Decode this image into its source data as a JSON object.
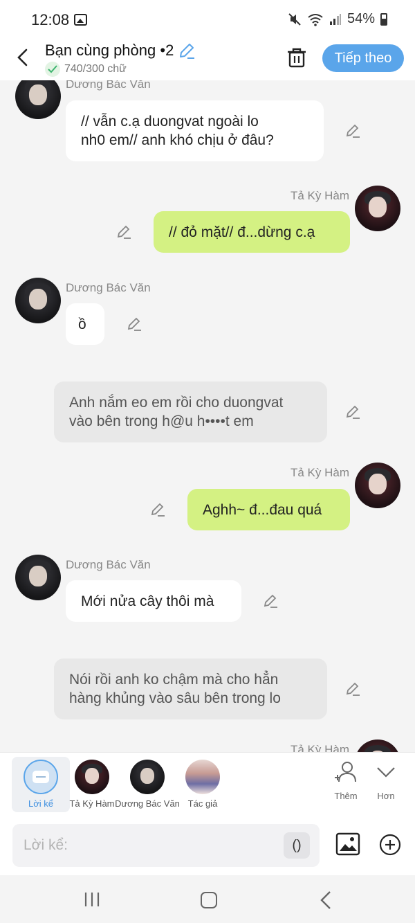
{
  "status_bar": {
    "time": "12:08",
    "battery": "54%"
  },
  "header": {
    "title": "Bạn cùng phòng •2",
    "subtitle": "740/300 chữ",
    "next_label": "Tiếp theo"
  },
  "messages": [
    {
      "sender": "Dương Bác Văn",
      "side": "left",
      "style": "white",
      "lines": [
        "// vẫn c.ạ duongvat ngoài lo",
        "nh0 em// anh khó chịu ở đâu?"
      ]
    },
    {
      "sender": "Tả Kỳ Hàm",
      "side": "right",
      "style": "green",
      "lines": [
        "// đỏ mặt// đ...dừng c.ạ"
      ]
    },
    {
      "sender": "Dương Bác Văn",
      "side": "left",
      "style": "white",
      "lines": [
        "ồ"
      ]
    },
    {
      "sender": "",
      "side": "narration",
      "style": "gray",
      "lines": [
        "Anh nắm eo em rồi cho duongvat",
        "vào bên trong h@u h••••t em"
      ]
    },
    {
      "sender": "Tả Kỳ Hàm",
      "side": "right",
      "style": "green",
      "lines": [
        "Aghh~ đ...đau quá"
      ]
    },
    {
      "sender": "Dương Bác Văn",
      "side": "left",
      "style": "white",
      "lines": [
        "Mới nửa cây thôi mà"
      ]
    },
    {
      "sender": "",
      "side": "narration",
      "style": "gray",
      "lines": [
        "Nói rồi anh ko chậm mà cho hẳn",
        "hàng khủng vào sâu bên trong lo"
      ]
    },
    {
      "sender": "Tả Kỳ Hàm",
      "side": "right",
      "style": "green",
      "lines": []
    }
  ],
  "characters": [
    {
      "label": "Lời kể",
      "active": true
    },
    {
      "label": "Tả Kỳ Hàm",
      "active": false
    },
    {
      "label": "Dương Bác Văn",
      "active": false
    },
    {
      "label": "Tác giả",
      "active": false
    }
  ],
  "tools": {
    "add_label": "Thêm",
    "more_label": "Hơn"
  },
  "composer": {
    "placeholder": "Lời kể:",
    "paren_label": "()"
  },
  "colors": {
    "accent": "#5aa5ea",
    "user_bubble": "#d4f183",
    "narration_bubble": "#e8e8e8"
  },
  "icons": [
    "gallery-icon",
    "mute-icon",
    "wifi-icon",
    "signal-icon",
    "battery-icon",
    "back-arrow-icon",
    "pencil-icon",
    "check-icon",
    "trash-icon",
    "add-person-icon",
    "chevron-down-icon",
    "image-icon",
    "plus-circle-icon",
    "recent-apps-icon",
    "home-icon",
    "nav-back-icon"
  ]
}
